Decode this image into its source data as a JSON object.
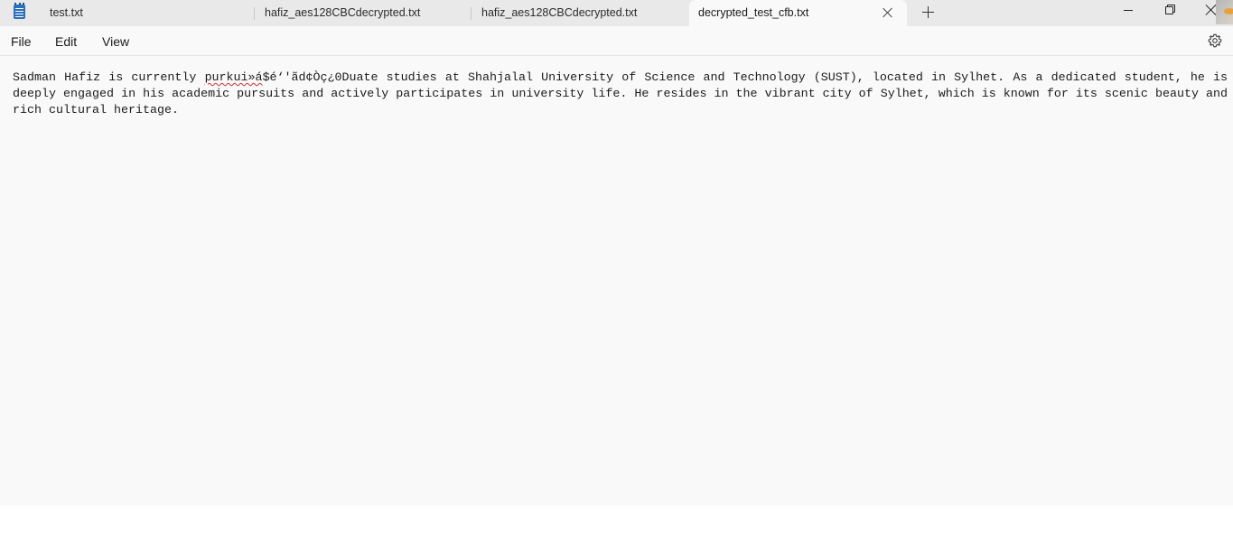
{
  "app": {
    "icon": "notepad-icon"
  },
  "tabs": [
    {
      "label": "test.txt",
      "active": false
    },
    {
      "label": "hafiz_aes128CBCdecrypted.txt",
      "active": false
    },
    {
      "label": "hafiz_aes128CBCdecrypted.txt",
      "active": false
    },
    {
      "label": "decrypted_test_cfb.txt",
      "active": true
    }
  ],
  "menu": {
    "file": "File",
    "edit": "Edit",
    "view": "View"
  },
  "editor": {
    "text_before_error": "Sadman Hafiz is currently ",
    "misspelled_word": "purkui»á",
    "text_after_error": "$é‘'ãd\u0011¢Òç¿0Duate studies at Shahjalal University of Science and Technology (SUST), located in Sylhet. As a dedicated student, he is deeply engaged in his academic pursuits and actively participates in university life. He resides in the vibrant city of Sylhet, which is known for its scenic beauty and rich cultural heritage."
  },
  "colors": {
    "titlebar": "#e9e9e9",
    "editor_background": "#f9f9f9",
    "spellcheck": "#d03030"
  }
}
